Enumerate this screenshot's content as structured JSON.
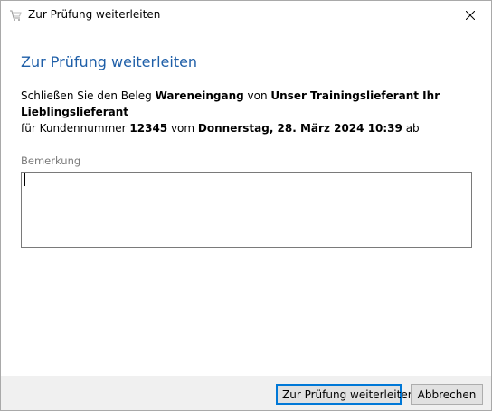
{
  "window": {
    "title": "Zur Prüfung weiterleiten",
    "app_icon": "cart-icon",
    "close_icon": "close-icon"
  },
  "dialog": {
    "heading": "Zur Prüfung weiterleiten",
    "description": {
      "p1": "Schließen Sie den Beleg ",
      "doc_type": "Wareneingang",
      "p2": " von ",
      "supplier": "Unser Trainingslieferant Ihr Lieblingslieferant",
      "p3": "für Kundennummer ",
      "customer_number": "12345",
      "p4": " vom ",
      "date": "Donnerstag, 28. März 2024 10:39",
      "p5": " ab"
    },
    "remark_label": "Bemerkung",
    "remark_value": ""
  },
  "buttons": {
    "submit_label": "Zur Prüfung weiterleiten",
    "cancel_label": "Abbrechen"
  },
  "colors": {
    "heading": "#1f5fa8",
    "primary_border": "#0078d7",
    "footer_bg": "#f0f0f0"
  }
}
